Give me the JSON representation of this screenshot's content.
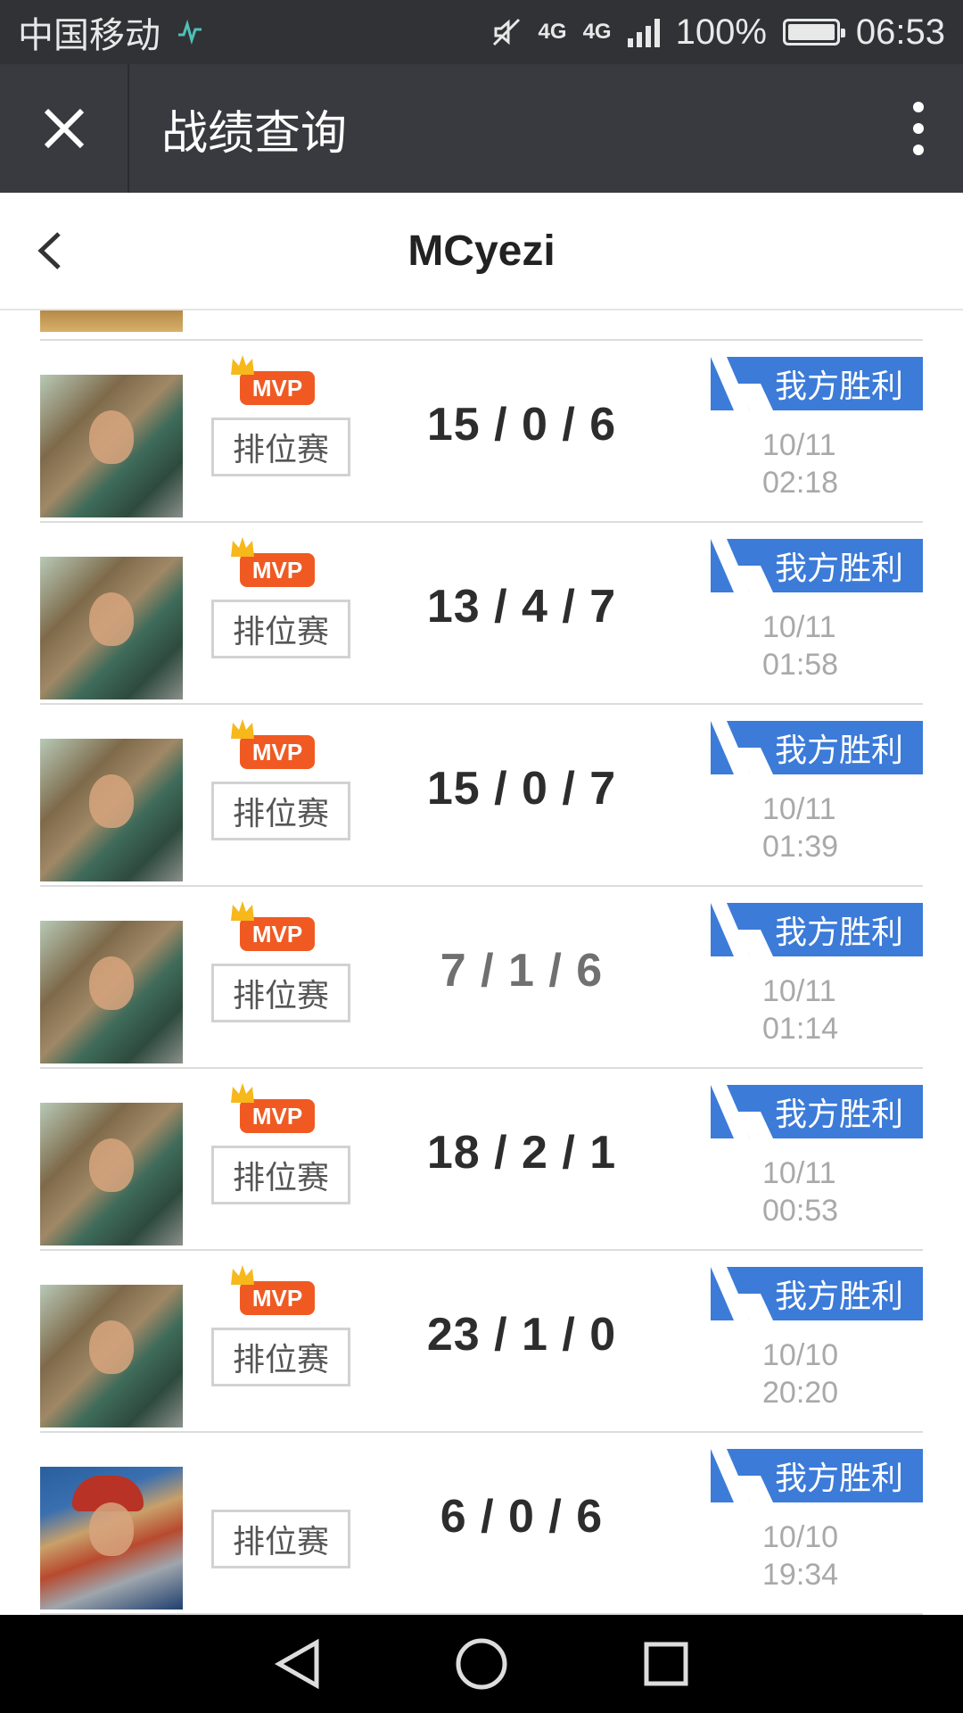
{
  "status_bar": {
    "carrier": "中国移动",
    "network_1": "4G",
    "network_2": "4G",
    "battery": "100%",
    "battery_level": 1.0,
    "time": "06:53"
  },
  "app_bar": {
    "title": "战绩查询"
  },
  "page": {
    "player_name": "MCyezi"
  },
  "matches": [
    {
      "mvp": "MVP",
      "mode": "排位赛",
      "kda": "15 / 0 / 6",
      "result": "我方胜利",
      "date": "10/11",
      "time": "02:18",
      "hero_icon": "hero-portrait-green"
    },
    {
      "mvp": "MVP",
      "mode": "排位赛",
      "kda": "13 / 4 / 7",
      "result": "我方胜利",
      "date": "10/11",
      "time": "01:58",
      "hero_icon": "hero-portrait-green"
    },
    {
      "mvp": "MVP",
      "mode": "排位赛",
      "kda": "15 / 0 / 7",
      "result": "我方胜利",
      "date": "10/11",
      "time": "01:39",
      "hero_icon": "hero-portrait-green"
    },
    {
      "mvp": "MVP",
      "mode": "排位赛",
      "kda": "7 / 1 / 6",
      "result": "我方胜利",
      "date": "10/11",
      "time": "01:14",
      "hero_icon": "hero-portrait-green"
    },
    {
      "mvp": "MVP",
      "mode": "排位赛",
      "kda": "18 / 2 / 1",
      "result": "我方胜利",
      "date": "10/11",
      "time": "00:53",
      "hero_icon": "hero-portrait-green"
    },
    {
      "mvp": "MVP",
      "mode": "排位赛",
      "kda": "23 / 1 / 0",
      "result": "我方胜利",
      "date": "10/10",
      "time": "20:20",
      "hero_icon": "hero-portrait-green"
    },
    {
      "mvp": "",
      "mode": "排位赛",
      "kda": "6 / 0 / 6",
      "result": "我方胜利",
      "date": "10/10",
      "time": "19:34",
      "hero_icon": "hero-portrait-red-hat"
    }
  ],
  "colors": {
    "win_badge": "#3c7bd8",
    "mvp_badge": "#f05a22",
    "app_bar": "#393a3f",
    "status_bar": "#303235"
  }
}
